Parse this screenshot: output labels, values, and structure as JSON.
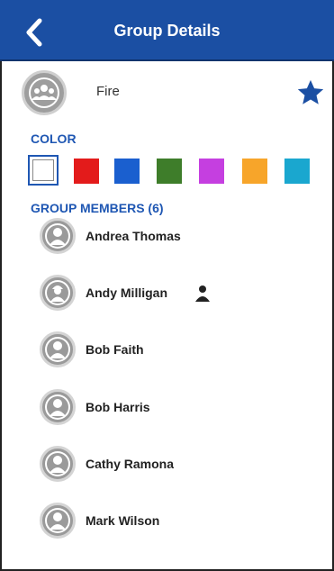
{
  "header": {
    "title": "Group Details"
  },
  "group": {
    "name": "Fire",
    "favorite": true
  },
  "color_section": {
    "label": "COLOR",
    "swatches": [
      {
        "color": "#ffffff",
        "selected": true
      },
      {
        "color": "#e31b1b",
        "selected": false
      },
      {
        "color": "#1a5fcf",
        "selected": false
      },
      {
        "color": "#3e7d2a",
        "selected": false
      },
      {
        "color": "#c53fe0",
        "selected": false
      },
      {
        "color": "#f7a52a",
        "selected": false
      },
      {
        "color": "#1aa7cf",
        "selected": false
      }
    ]
  },
  "members_section": {
    "label": "GROUP MEMBERS (6)",
    "members": [
      {
        "name": "Andrea Thomas",
        "admin": false
      },
      {
        "name": "Andy Milligan",
        "admin": true
      },
      {
        "name": "Bob Faith",
        "admin": false
      },
      {
        "name": "Bob Harris",
        "admin": false
      },
      {
        "name": "Cathy Ramona",
        "admin": false
      },
      {
        "name": "Mark Wilson",
        "admin": false
      }
    ]
  },
  "colors": {
    "header_bg": "#1b4fa3",
    "accent": "#1f57b3",
    "star": "#1b4fa3"
  }
}
